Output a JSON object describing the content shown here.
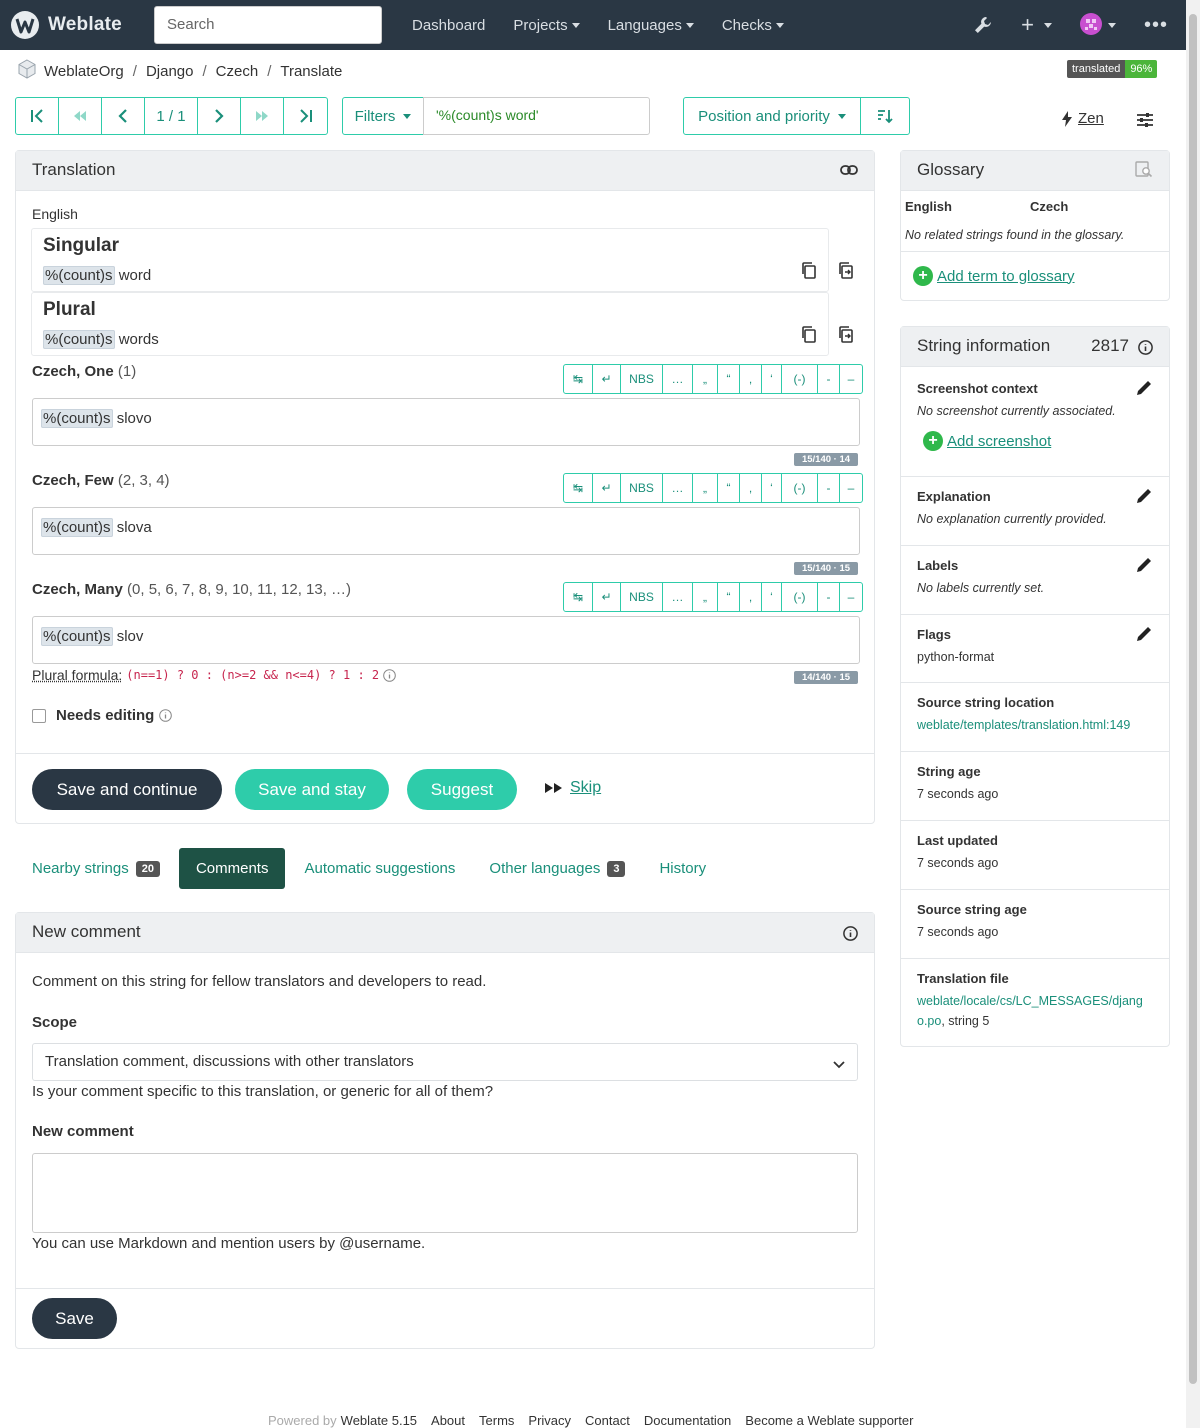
{
  "navbar": {
    "brand": "Weblate",
    "search_placeholder": "Search",
    "menu": [
      "Dashboard",
      "Projects",
      "Languages",
      "Checks"
    ]
  },
  "breadcrumb": [
    "WeblateOrg",
    "Django",
    "Czech",
    "Translate"
  ],
  "status_badge": {
    "label": "translated",
    "value": "96%"
  },
  "pager": {
    "position": "1 / 1"
  },
  "filters": {
    "label": "Filters",
    "query": "'%(count)s word'"
  },
  "sort": {
    "label": "Position and priority"
  },
  "zen": {
    "label": "Zen"
  },
  "translation": {
    "heading": "Translation",
    "source_language": "English",
    "sources": [
      {
        "form": "Singular",
        "placeholder": "%(count)s",
        "text": " word"
      },
      {
        "form": "Plural",
        "placeholder": "%(count)s",
        "text": " words"
      }
    ],
    "char_buttons": [
      "↹",
      "↵",
      "NBS",
      "…",
      "„",
      "“",
      ",",
      "‘",
      "(-)",
      "-",
      "–"
    ],
    "targets": [
      {
        "label": "Czech, One",
        "numbers": "(1)",
        "placeholder": "%(count)s",
        "text": " slovo",
        "counter": "15/140 · 14"
      },
      {
        "label": "Czech, Few",
        "numbers": "(2, 3, 4)",
        "placeholder": "%(count)s",
        "text": " slova",
        "counter": "15/140 · 15"
      },
      {
        "label": "Czech, Many",
        "numbers": "(0, 5, 6, 7, 8, 9, 10, 11, 12, 13, …)",
        "placeholder": "%(count)s",
        "text": " slov",
        "counter": "14/140 · 15"
      }
    ],
    "plural_formula_label": "Plural formula:",
    "plural_formula": "(n==1) ? 0 : (n>=2 && n<=4) ? 1 : 2",
    "needs_editing": "Needs editing",
    "buttons": {
      "save_continue": "Save and continue",
      "save_stay": "Save and stay",
      "suggest": "Suggest",
      "skip": "Skip"
    }
  },
  "tabs": [
    {
      "label": "Nearby strings",
      "count": "20"
    },
    {
      "label": "Comments",
      "count": ""
    },
    {
      "label": "Automatic suggestions",
      "count": ""
    },
    {
      "label": "Other languages",
      "count": "3"
    },
    {
      "label": "History",
      "count": ""
    }
  ],
  "comment": {
    "heading": "New comment",
    "intro": "Comment on this string for fellow translators and developers to read.",
    "scope_label": "Scope",
    "scope_value": "Translation comment, discussions with other translators",
    "scope_help": "Is your comment specific to this translation, or generic for all of them?",
    "new_comment_label": "New comment",
    "markdown_help": "You can use Markdown and mention users by @username.",
    "save": "Save"
  },
  "glossary": {
    "heading": "Glossary",
    "col_source": "English",
    "col_target": "Czech",
    "empty": "No related strings found in the glossary.",
    "add": "Add term to glossary"
  },
  "string_info": {
    "heading": "String information",
    "id": "2817",
    "screenshot_title": "Screenshot context",
    "screenshot_value": "No screenshot currently associated.",
    "add_screenshot": "Add screenshot",
    "explanation_title": "Explanation",
    "explanation_value": "No explanation currently provided.",
    "labels_title": "Labels",
    "labels_value": "No labels currently set.",
    "flags_title": "Flags",
    "flags_value": "python-format",
    "location_title": "Source string location",
    "location_value": "weblate/templates/translation.html:149",
    "age_title": "String age",
    "age_value": "7 seconds ago",
    "updated_title": "Last updated",
    "updated_value": "7 seconds ago",
    "source_age_title": "Source string age",
    "source_age_value": "7 seconds ago",
    "file_title": "Translation file",
    "file_link_1": "weblate/locale/cs/LC_MESSAGES/djang",
    "file_link_2": "o.po",
    "file_suffix": ", string 5"
  },
  "footer": {
    "powered_by": "Powered by",
    "version": "Weblate 5.15",
    "links": [
      "About",
      "Terms",
      "Privacy",
      "Contact",
      "Documentation",
      "Become a Weblate supporter"
    ]
  },
  "colors": {
    "navbar": "#2a3744",
    "accent": "#2eccaa",
    "link": "#1a8f7a",
    "dark_button": "#2a3744",
    "active_tab": "#1e5245",
    "badge_ok": "#4bb53a"
  }
}
